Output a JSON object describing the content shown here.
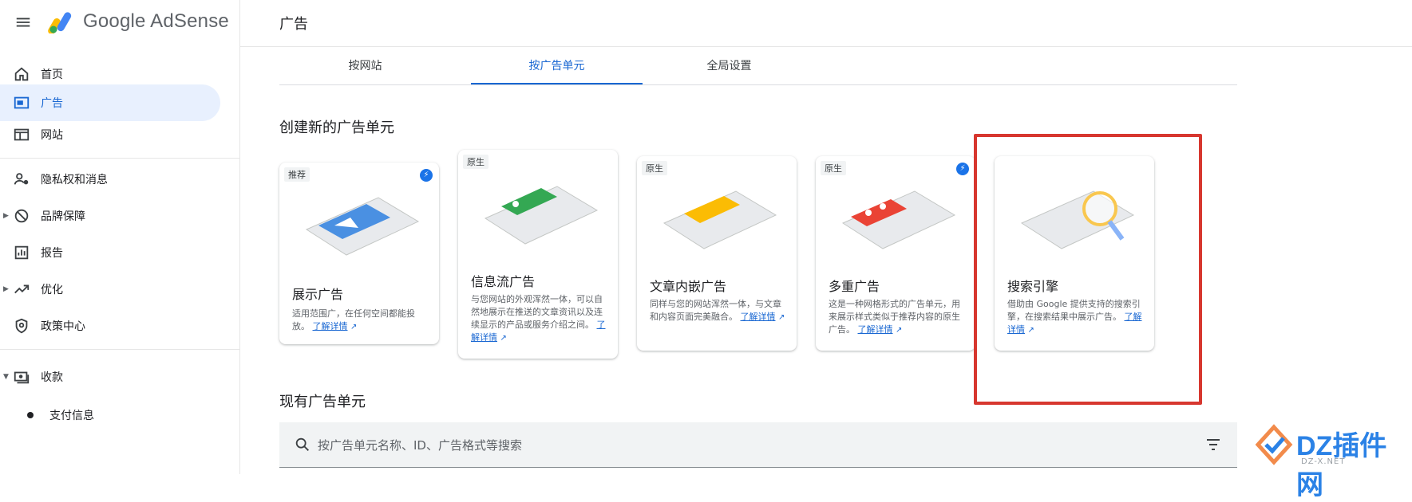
{
  "header": {
    "brand": "Google AdSense",
    "page_title": "广告"
  },
  "sidebar": {
    "items": [
      {
        "label": "首页",
        "icon": "home-icon"
      },
      {
        "label": "广告",
        "icon": "ads-icon",
        "active": true
      },
      {
        "label": "网站",
        "icon": "sites-icon"
      },
      {
        "label": "隐私权和消息",
        "icon": "privacy-icon"
      },
      {
        "label": "品牌保障",
        "icon": "block-icon"
      },
      {
        "label": "报告",
        "icon": "reports-icon"
      },
      {
        "label": "优化",
        "icon": "trending-icon"
      },
      {
        "label": "政策中心",
        "icon": "policy-icon"
      },
      {
        "label": "收款",
        "icon": "payments-icon"
      },
      {
        "label": "支付信息",
        "icon": "dot-icon"
      }
    ]
  },
  "tabs": [
    {
      "label": "按网站"
    },
    {
      "label": "按广告单元",
      "active": true
    },
    {
      "label": "全局设置"
    }
  ],
  "create_section": {
    "title": "创建新的广告单元"
  },
  "cards": [
    {
      "tag": "推荐",
      "title": "展示广告",
      "desc": "适用范围广，在任何空间都能投放。",
      "link": "了解详情",
      "accent": "#4a90e2"
    },
    {
      "tag": "原生",
      "title": "信息流广告",
      "desc": "与您网站的外观浑然一体，可以自然地展示在推送的文章资讯以及连续显示的产品或服务介绍之间。",
      "link": "了解详情",
      "accent": "#34a853"
    },
    {
      "tag": "原生",
      "title": "文章内嵌广告",
      "desc": "同样与您的网站浑然一体，与文章和内容页面完美融合。",
      "link": "了解详情",
      "accent": "#fbbc04"
    },
    {
      "tag": "原生",
      "title": "多重广告",
      "desc": "这是一种网格形式的广告单元，用来展示样式类似于推荐内容的原生广告。",
      "link": "了解详情",
      "accent": "#ea4335"
    },
    {
      "tag": "",
      "title": "搜索引擎",
      "desc": "借助由 Google 提供支持的搜索引擎，在搜索结果中展示广告。",
      "link": "了解详情",
      "accent": "#f9c74f"
    }
  ],
  "existing_section": {
    "title": "现有广告单元"
  },
  "search": {
    "placeholder": "按广告单元名称、ID、广告格式等搜索"
  },
  "watermark": {
    "text": "DZ插件网",
    "sub": "DZ-X.NET"
  },
  "colors": {
    "active_blue": "#1967d2",
    "highlight_red": "#d7372f"
  }
}
